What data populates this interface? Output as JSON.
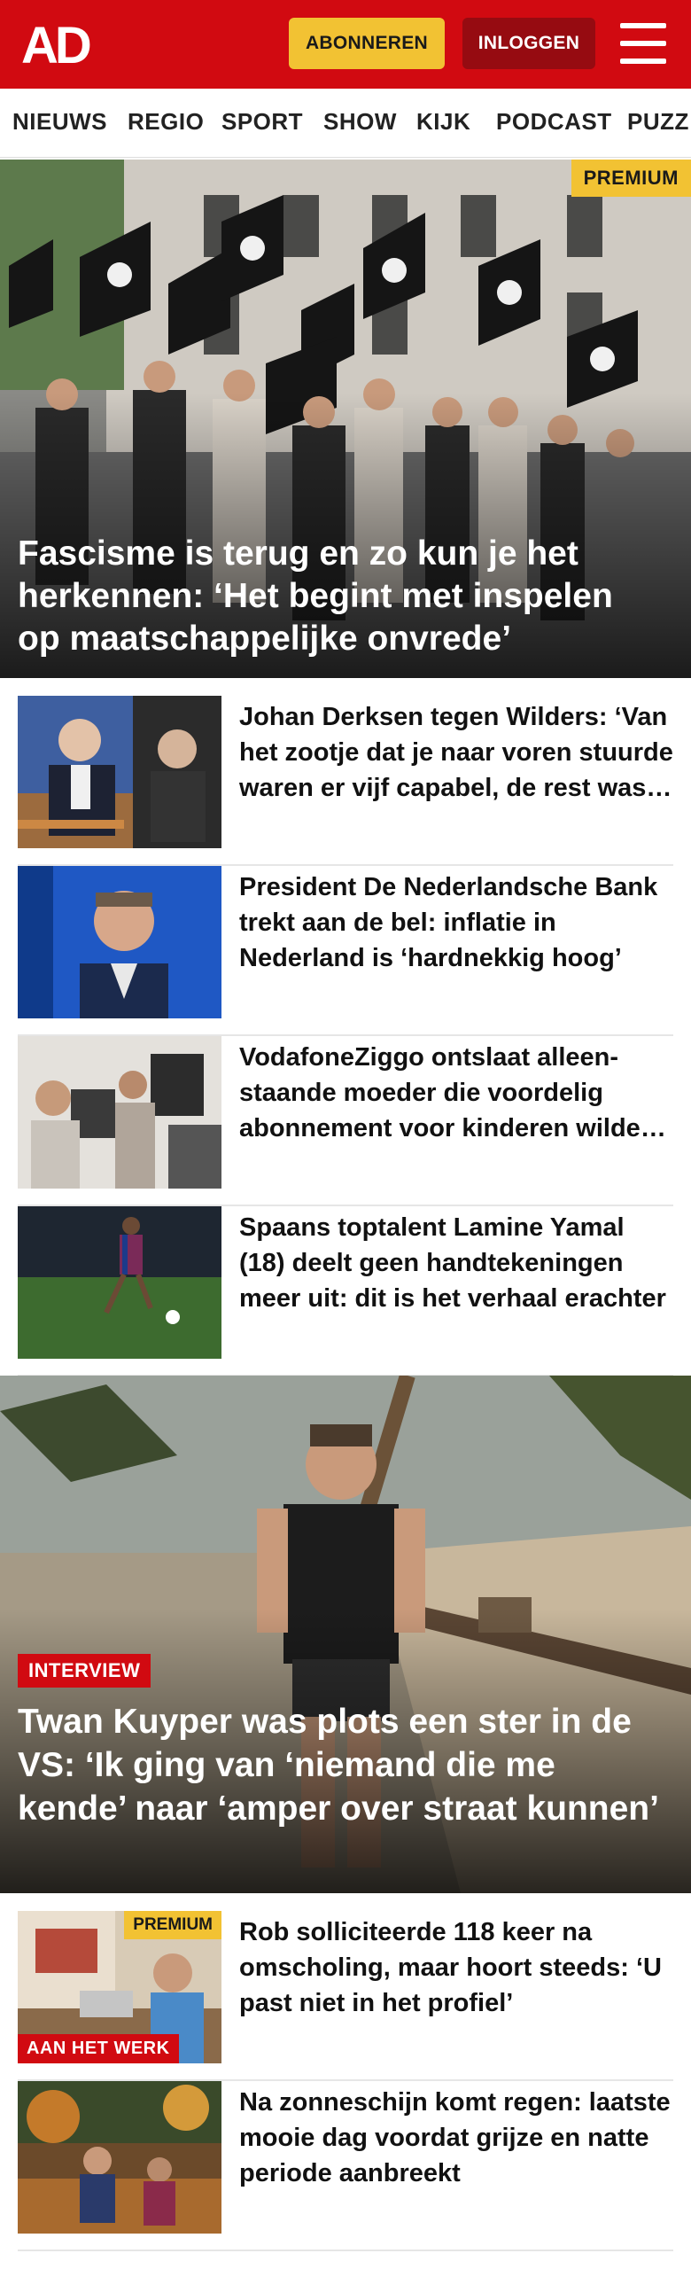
{
  "header": {
    "logo_text": "AD",
    "subscribe_label": "ABONNEREN",
    "login_label": "INLOGGEN",
    "menu_icon": "hamburger-menu-icon",
    "brand_color": "#d10a11"
  },
  "nav": {
    "items": [
      "NIEUWS",
      "REGIO",
      "SPORT",
      "SHOW",
      "KIJK",
      "PODCAST",
      "PUZZ"
    ]
  },
  "hero": {
    "tag": "PREMIUM",
    "title": "Fascisme is terug en zo kun je het herkennen: ‘Het begint met inspelen op maatschappelijke onvrede’"
  },
  "articles": [
    {
      "title": "Johan Derksen tegen Wilders: ‘Van het zootje dat je naar voren stuurde waren er vijf capabel, de rest was een stelletje dwazen’"
    },
    {
      "title": "President De Nederlandsche Bank trekt aan de bel: inflatie in Nederland is ‘hardnekkig hoog’"
    },
    {
      "title": "VodafoneZiggo ontslaat alleen­staande moeder die voordelig abonnement voor kinderen wilde regelen"
    },
    {
      "title": "Spaans toptalent Lamine Yamal (18) deelt geen handtekeningen meer uit: dit is het verhaal erachter"
    }
  ],
  "feature": {
    "label": "INTERVIEW",
    "title": "Twan Kuyper was plots een ster in de VS: ‘Ik ging van ‘niemand die me kende’ naar ‘amper over straat kunnen’"
  },
  "articles2": [
    {
      "premium": "PREMIUM",
      "label": "AAN HET WERK",
      "title": "Rob solliciteerde 118 keer na omscholing, maar hoort steeds: ‘U past niet in het profiel’"
    },
    {
      "title": "Na zonneschijn komt regen: laatste mooie dag voordat grijze en natte periode aanbreekt"
    }
  ]
}
